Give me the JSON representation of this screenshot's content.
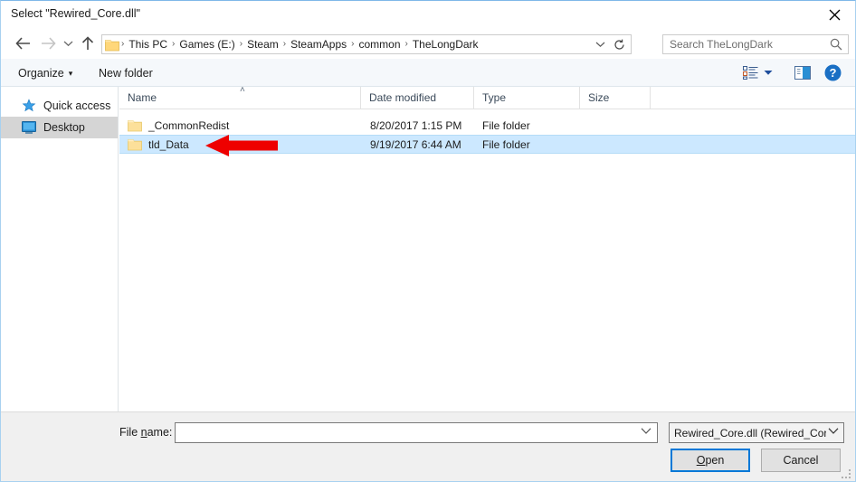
{
  "window": {
    "title": "Select \"Rewired_Core.dll\"",
    "close_label": "close-icon",
    "accent_color": "#0078d7",
    "selection_color": "#cce8ff"
  },
  "nav": {
    "back_label": "Back",
    "forward_label": "Forward",
    "recent_label": "Recent locations",
    "up_label": "Up one level",
    "refresh_label": "Refresh",
    "dropdown_label": "Previous locations"
  },
  "address": {
    "folder_icon": "folder-icon",
    "separator": "›",
    "crumbs": [
      "This PC",
      "Games (E:)",
      "Steam",
      "SteamApps",
      "common",
      "TheLongDark"
    ]
  },
  "search": {
    "placeholder": "Search TheLongDark",
    "icon": "search-icon"
  },
  "toolbar": {
    "organize_label": "Organize",
    "organize_caret": "▾",
    "new_folder_label": "New folder",
    "view_options_label": "Change your view",
    "view_caret": "▾",
    "preview_pane_label": "Show the preview pane",
    "help_label": "?"
  },
  "sidebar": {
    "items": [
      {
        "label": "Quick access",
        "icon": "star-icon",
        "selected": false
      },
      {
        "label": "Desktop",
        "icon": "desktop-icon",
        "selected": true
      }
    ]
  },
  "filelist": {
    "columns": [
      {
        "label": "Name",
        "sorted": true,
        "sort_caret": "˄"
      },
      {
        "label": "Date modified",
        "sorted": false
      },
      {
        "label": "Type",
        "sorted": false
      },
      {
        "label": "Size",
        "sorted": false
      }
    ],
    "rows": [
      {
        "name": "_CommonRedist",
        "date_modified": "8/20/2017 1:15 PM",
        "type": "File folder",
        "size": "",
        "icon": "folder-icon",
        "selected": false
      },
      {
        "name": "tld_Data",
        "date_modified": "9/19/2017 6:44 AM",
        "type": "File folder",
        "size": "",
        "icon": "folder-icon",
        "selected": true
      }
    ]
  },
  "annotation": {
    "arrow_color": "#ee0000",
    "arrow_direction": "left",
    "target_row": "tld_Data"
  },
  "footer": {
    "filename_label_pre": "File ",
    "filename_label_key": "n",
    "filename_label_post": "ame:",
    "filename_value": "",
    "filename_placeholder": "",
    "filetype_value": "Rewired_Core.dll (Rewired_Core",
    "open_label_key": "O",
    "open_label_post": "pen",
    "cancel_label": "Cancel"
  }
}
